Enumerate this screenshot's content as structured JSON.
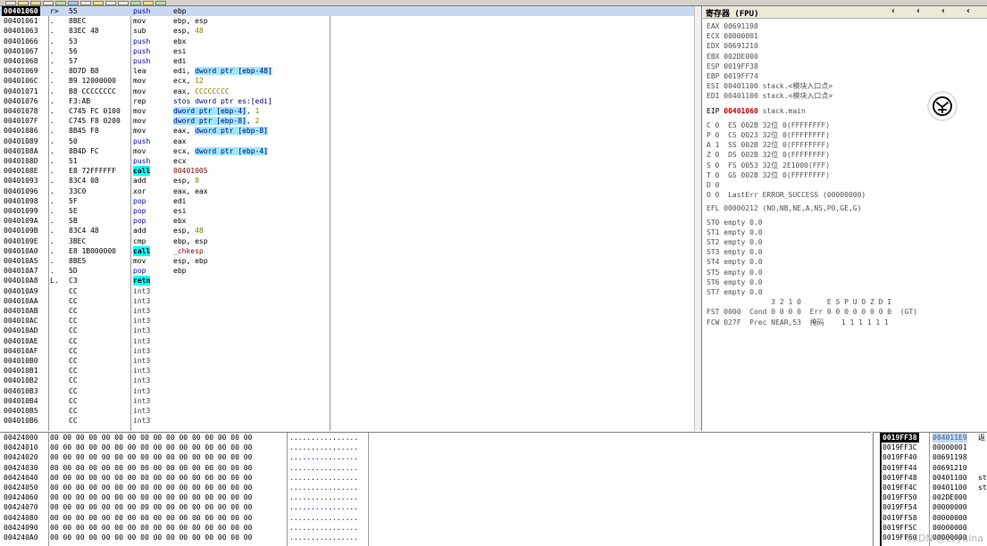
{
  "toolbar": {
    "buttons": [
      "btn",
      "btn",
      "btn",
      "btn",
      "btn",
      "btn",
      "btn",
      "btn",
      "btn",
      "btn",
      "btn",
      "btn",
      "btn"
    ]
  },
  "disasm": [
    {
      "addr": "00401060",
      "mark": "r>",
      "hex": "55",
      "mn": "push",
      "op": [
        {
          "t": "ebp"
        }
      ],
      "selected": true
    },
    {
      "addr": "00401061",
      "mark": ".",
      "hex": "8BEC",
      "mn": "mov",
      "op": [
        {
          "t": "ebp, esp"
        }
      ]
    },
    {
      "addr": "00401063",
      "mark": ".",
      "hex": "83EC 48",
      "mn": "sub",
      "op": [
        {
          "t": "esp, "
        },
        {
          "t": "48",
          "c": "num"
        }
      ]
    },
    {
      "addr": "00401066",
      "mark": ".",
      "hex": "53",
      "mn": "push",
      "op": [
        {
          "t": "ebx"
        }
      ]
    },
    {
      "addr": "00401067",
      "mark": ".",
      "hex": "56",
      "mn": "push",
      "op": [
        {
          "t": "esi"
        }
      ]
    },
    {
      "addr": "00401068",
      "mark": ".",
      "hex": "57",
      "mn": "push",
      "op": [
        {
          "t": "edi"
        }
      ]
    },
    {
      "addr": "00401069",
      "mark": ".",
      "hex": "8D7D B8",
      "mn": "lea",
      "op": [
        {
          "t": "edi, "
        },
        {
          "t": "dword ptr [ebp-48]",
          "c": "ptr"
        }
      ]
    },
    {
      "addr": "0040106C",
      "mark": ".",
      "hex": "B9 12000000",
      "mn": "mov",
      "op": [
        {
          "t": "ecx, "
        },
        {
          "t": "12",
          "c": "num"
        }
      ]
    },
    {
      "addr": "00401071",
      "mark": ".",
      "hex": "B8 CCCCCCCC",
      "mn": "mov",
      "op": [
        {
          "t": "eax, "
        },
        {
          "t": "CCCCCCCC",
          "c": "num"
        }
      ]
    },
    {
      "addr": "00401076",
      "mark": ".",
      "hex": "F3:AB",
      "mn": "rep",
      "op": [
        {
          "t": "stos dword ptr es:[edi]",
          "c": "ptr-n"
        }
      ]
    },
    {
      "addr": "00401078",
      "mark": ".",
      "hex": "C745 FC 0100",
      "mn": "mov",
      "op": [
        {
          "t": "dword ptr [ebp-4]",
          "c": "ptr"
        },
        {
          "t": ", "
        },
        {
          "t": "1",
          "c": "num"
        }
      ]
    },
    {
      "addr": "0040107F",
      "mark": ".",
      "hex": "C745 F8 0200",
      "mn": "mov",
      "op": [
        {
          "t": "dword ptr [ebp-8]",
          "c": "ptr"
        },
        {
          "t": ", "
        },
        {
          "t": "2",
          "c": "num"
        }
      ]
    },
    {
      "addr": "00401086",
      "mark": ".",
      "hex": "8B45 F8",
      "mn": "mov",
      "op": [
        {
          "t": "eax, "
        },
        {
          "t": "dword ptr [ebp-8]",
          "c": "ptr"
        }
      ]
    },
    {
      "addr": "00401089",
      "mark": ".",
      "hex": "50",
      "mn": "push",
      "op": [
        {
          "t": "eax"
        }
      ]
    },
    {
      "addr": "0040108A",
      "mark": ".",
      "hex": "8B4D FC",
      "mn": "mov",
      "op": [
        {
          "t": "ecx, "
        },
        {
          "t": "dword ptr [ebp-4]",
          "c": "ptr"
        }
      ]
    },
    {
      "addr": "0040108D",
      "mark": ".",
      "hex": "51",
      "mn": "push",
      "op": [
        {
          "t": "ecx"
        }
      ]
    },
    {
      "addr": "0040108E",
      "mark": ".",
      "hex": "E8 72FFFFFF",
      "mn": "call",
      "op": [
        {
          "t": "00401005",
          "c": "calladdr"
        }
      ],
      "mnc": "call"
    },
    {
      "addr": "00401093",
      "mark": ".",
      "hex": "83C4 08",
      "mn": "add",
      "op": [
        {
          "t": "esp, "
        },
        {
          "t": "8",
          "c": "num"
        }
      ]
    },
    {
      "addr": "00401096",
      "mark": ".",
      "hex": "33C0",
      "mn": "xor",
      "op": [
        {
          "t": "eax, eax"
        }
      ]
    },
    {
      "addr": "00401098",
      "mark": ".",
      "hex": "5F",
      "mn": "pop",
      "op": [
        {
          "t": "edi"
        }
      ]
    },
    {
      "addr": "00401099",
      "mark": ".",
      "hex": "5E",
      "mn": "pop",
      "op": [
        {
          "t": "esi"
        }
      ]
    },
    {
      "addr": "0040109A",
      "mark": ".",
      "hex": "5B",
      "mn": "pop",
      "op": [
        {
          "t": "ebx"
        }
      ]
    },
    {
      "addr": "0040109B",
      "mark": ".",
      "hex": "83C4 48",
      "mn": "add",
      "op": [
        {
          "t": "esp, "
        },
        {
          "t": "48",
          "c": "num"
        }
      ]
    },
    {
      "addr": "0040109E",
      "mark": ".",
      "hex": "3BEC",
      "mn": "cmp",
      "op": [
        {
          "t": "ebp, esp"
        }
      ]
    },
    {
      "addr": "004010A0",
      "mark": ".",
      "hex": "E8 1B000000",
      "mn": "call",
      "op": [
        {
          "t": "_chkesp",
          "c": "chk"
        }
      ],
      "mnc": "call"
    },
    {
      "addr": "004010A5",
      "mark": ".",
      "hex": "8BE5",
      "mn": "mov",
      "op": [
        {
          "t": "esp, ebp"
        }
      ]
    },
    {
      "addr": "004010A7",
      "mark": ".",
      "hex": "5D",
      "mn": "pop",
      "op": [
        {
          "t": "ebp"
        }
      ]
    },
    {
      "addr": "004010A8",
      "mark": "L.",
      "hex": "C3",
      "mn": "retn",
      "op": [],
      "mnc": "ret"
    },
    {
      "addr": "004010A9",
      "mark": "",
      "hex": "CC",
      "mn": "int3",
      "op": [],
      "mnc": "gray"
    },
    {
      "addr": "004010AA",
      "mark": "",
      "hex": "CC",
      "mn": "int3",
      "op": [],
      "mnc": "gray"
    },
    {
      "addr": "004010AB",
      "mark": "",
      "hex": "CC",
      "mn": "int3",
      "op": [],
      "mnc": "gray"
    },
    {
      "addr": "004010AC",
      "mark": "",
      "hex": "CC",
      "mn": "int3",
      "op": [],
      "mnc": "gray"
    },
    {
      "addr": "004010AD",
      "mark": "",
      "hex": "CC",
      "mn": "int3",
      "op": [],
      "mnc": "gray"
    },
    {
      "addr": "004010AE",
      "mark": "",
      "hex": "CC",
      "mn": "int3",
      "op": [],
      "mnc": "gray"
    },
    {
      "addr": "004010AF",
      "mark": "",
      "hex": "CC",
      "mn": "int3",
      "op": [],
      "mnc": "gray"
    },
    {
      "addr": "004010B0",
      "mark": "",
      "hex": "CC",
      "mn": "int3",
      "op": [],
      "mnc": "gray"
    },
    {
      "addr": "004010B1",
      "mark": "",
      "hex": "CC",
      "mn": "int3",
      "op": [],
      "mnc": "gray"
    },
    {
      "addr": "004010B2",
      "mark": "",
      "hex": "CC",
      "mn": "int3",
      "op": [],
      "mnc": "gray"
    },
    {
      "addr": "004010B3",
      "mark": "",
      "hex": "CC",
      "mn": "int3",
      "op": [],
      "mnc": "gray"
    },
    {
      "addr": "004010B4",
      "mark": "",
      "hex": "CC",
      "mn": "int3",
      "op": [],
      "mnc": "gray"
    },
    {
      "addr": "004010B5",
      "mark": "",
      "hex": "CC",
      "mn": "int3",
      "op": [],
      "mnc": "gray"
    },
    {
      "addr": "004010B6",
      "mark": "",
      "hex": "CC",
      "mn": "int3",
      "op": [],
      "mnc": "gray"
    }
  ],
  "registers": {
    "title": "寄存器 (FPU)",
    "lines": [
      "EAX 00691198",
      "ECX 00000001",
      "EDX 00691210",
      "EBX 002DE000",
      "ESP 0019FF38",
      "EBP 0019FF74",
      "ESI 00401100 stack.<模块入口点>",
      "EDI 00401100 stack.<模块入口点>"
    ],
    "eip_label": "EIP",
    "eip_value": "00401060",
    "eip_target": "stack.main",
    "flags": [
      "C 0  ES 002B 32位 0(FFFFFFFF)",
      "P 0  CS 0023 32位 0(FFFFFFFF)",
      "A 1  SS 002B 32位 0(FFFFFFFF)",
      "Z 0  DS 002B 32位 0(FFFFFFFF)",
      "S 0  FS 0053 32位 2E1000(FFF)",
      "T 0  GS 002B 32位 0(FFFFFFFF)",
      "D 0",
      "O 0  LastErr ERROR_SUCCESS (00000000)"
    ],
    "efl": "EFL 00000212 (NO,NB,NE,A,NS,PO,GE,G)",
    "fpu": [
      "ST0 empty 0.0",
      "ST1 empty 0.0",
      "ST2 empty 0.0",
      "ST3 empty 0.0",
      "ST4 empty 0.0",
      "ST5 empty 0.0",
      "ST6 empty 0.0",
      "ST7 empty 0.0"
    ],
    "fpu_header": "               3 2 1 0      E S P U O Z D I",
    "fst": "FST 0000  Cond 0 0 0 0  Err 0 0 0 0 0 0 0 0  (GT)",
    "fcw": "FCW 027F  Prec NEAR,53  掩码    1 1 1 1 1 1"
  },
  "dump": [
    {
      "addr": "00424000",
      "hex": "00 00 00 00 00 00 00 00 00 00 00 00 00 00 00 00",
      "ascii": "................"
    },
    {
      "addr": "00424010",
      "hex": "00 00 00 00 00 00 00 00 00 00 00 00 00 00 00 00",
      "ascii": "................"
    },
    {
      "addr": "00424020",
      "hex": "00 00 00 00 00 00 00 00 00 00 00 00 00 00 00 00",
      "ascii": "................"
    },
    {
      "addr": "00424030",
      "hex": "00 00 00 00 00 00 00 00 00 00 00 00 00 00 00 00",
      "ascii": "................"
    },
    {
      "addr": "00424040",
      "hex": "00 00 00 00 00 00 00 00 00 00 00 00 00 00 00 00",
      "ascii": "................"
    },
    {
      "addr": "00424050",
      "hex": "00 00 00 00 00 00 00 00 00 00 00 00 00 00 00 00",
      "ascii": "................"
    },
    {
      "addr": "00424060",
      "hex": "00 00 00 00 00 00 00 00 00 00 00 00 00 00 00 00",
      "ascii": "................"
    },
    {
      "addr": "00424070",
      "hex": "00 00 00 00 00 00 00 00 00 00 00 00 00 00 00 00",
      "ascii": "................"
    },
    {
      "addr": "00424080",
      "hex": "00 00 00 00 00 00 00 00 00 00 00 00 00 00 00 00",
      "ascii": "................"
    },
    {
      "addr": "00424090",
      "hex": "00 00 00 00 00 00 00 00 00 00 00 00 00 00 00 00",
      "ascii": "................"
    },
    {
      "addr": "004240A0",
      "hex": "00 00 00 00 00 00 00 00 00 00 00 00 00 00 00 00",
      "ascii": "................"
    }
  ],
  "stack": [
    {
      "addr": "0019FF38",
      "val": "004011E9",
      "com": "返",
      "selected": true
    },
    {
      "addr": "0019FF3C",
      "val": "00000001",
      "com": ""
    },
    {
      "addr": "0019FF40",
      "val": "00691198",
      "com": ""
    },
    {
      "addr": "0019FF44",
      "val": "00691210",
      "com": ""
    },
    {
      "addr": "0019FF48",
      "val": "00401100",
      "com": "st"
    },
    {
      "addr": "0019FF4C",
      "val": "00401100",
      "com": "st"
    },
    {
      "addr": "0019FF50",
      "val": "002DE000",
      "com": ""
    },
    {
      "addr": "0019FF54",
      "val": "00000000",
      "com": ""
    },
    {
      "addr": "0019FF58",
      "val": "00000000",
      "com": ""
    },
    {
      "addr": "0019FF5C",
      "val": "00000000",
      "com": ""
    },
    {
      "addr": "0019FF60",
      "val": "00000000",
      "com": ""
    }
  ],
  "watermark": "CSDN @zzynlna",
  "colors": {
    "selection": "#c8d8f0",
    "highlight": "#00ffff",
    "mnemonic": "#0000c0",
    "eip": "#c00000"
  }
}
